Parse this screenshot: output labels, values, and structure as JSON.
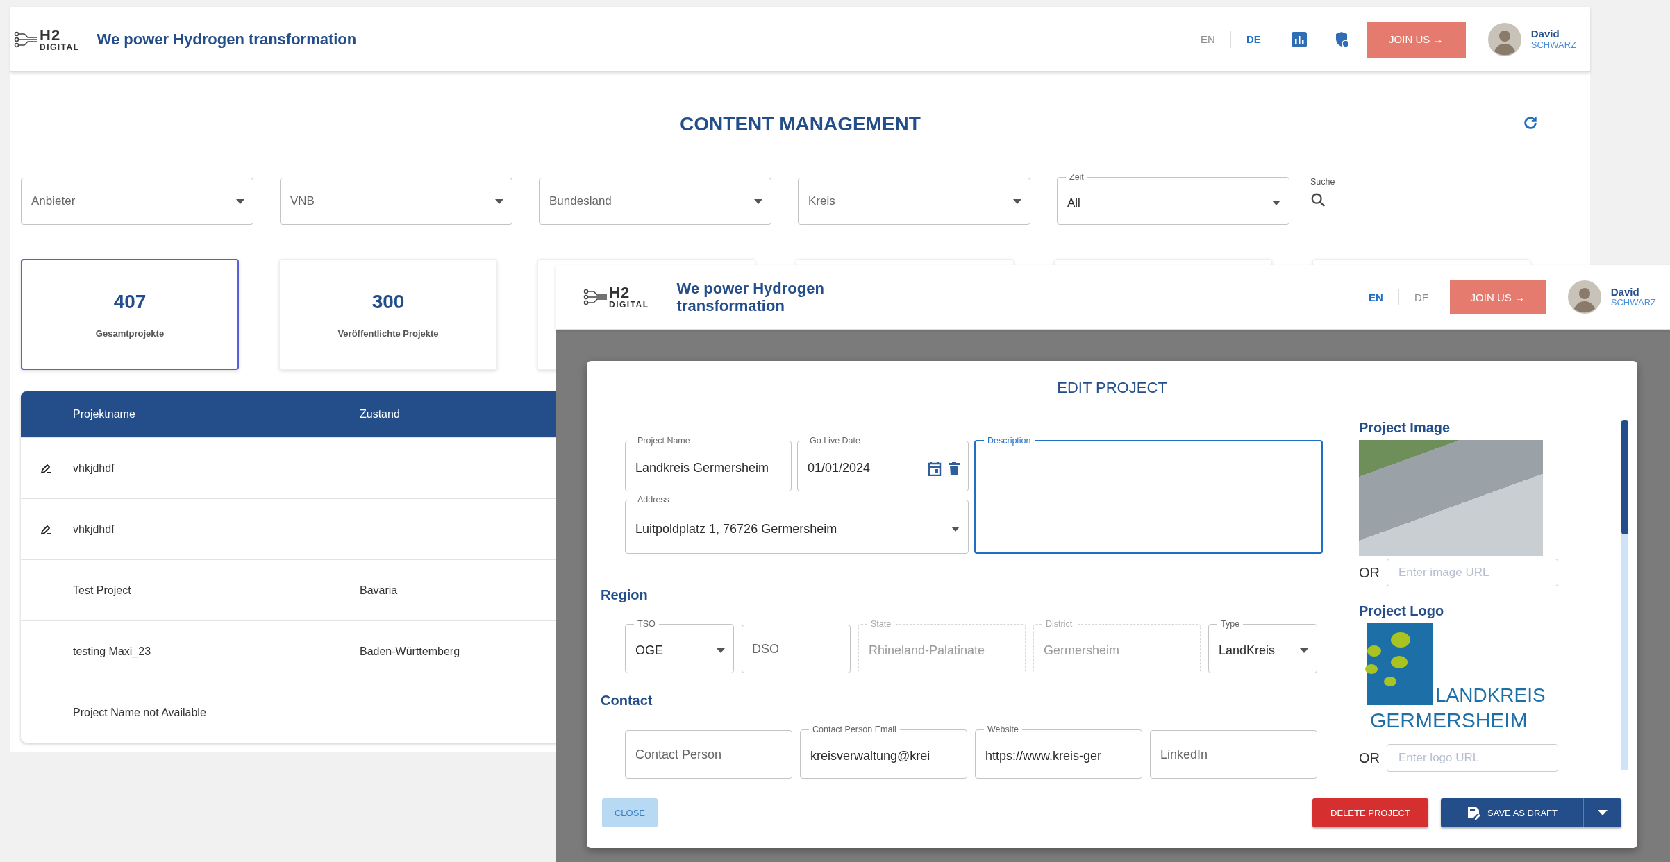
{
  "back_window": {
    "header": {
      "logo": {
        "mark": "H2",
        "word": "DIGITAL"
      },
      "tagline": "We power Hydrogen transformation",
      "languages": [
        {
          "label": "EN",
          "selected": false
        },
        {
          "label": "DE",
          "selected": true
        }
      ],
      "join_button": "JOIN US →",
      "user": {
        "first_name": "David",
        "last_name": "SCHWARZ"
      }
    },
    "title": "CONTENT MANAGEMENT",
    "filters": [
      {
        "kind": "select",
        "placeholder": "Anbieter"
      },
      {
        "kind": "select",
        "placeholder": "VNB"
      },
      {
        "kind": "select",
        "placeholder": "Bundesland"
      },
      {
        "kind": "select",
        "placeholder": "Kreis"
      },
      {
        "kind": "select",
        "label": "Zeit",
        "value": "All"
      }
    ],
    "search": {
      "label": "Suche"
    },
    "cards": [
      {
        "value": "407",
        "label": "Gesamtprojekte",
        "selected": true
      },
      {
        "value": "300",
        "label": "Veröffentlichte Projekte",
        "selected": false
      },
      {
        "selected": false
      },
      {
        "selected": false
      },
      {
        "selected": false
      },
      {
        "selected": false
      }
    ],
    "table": {
      "columns": [
        "Projektname",
        "Zustand"
      ],
      "rows": [
        {
          "editable": true,
          "name": "vhkjdhdf"
        },
        {
          "editable": true,
          "name": "vhkjdhdf"
        },
        {
          "editable": false,
          "name": "Test Project",
          "state": "Bavaria"
        },
        {
          "editable": false,
          "name": "testing Maxi_23",
          "state": "Baden-Württemberg"
        },
        {
          "editable": false,
          "name": "Project Name not Available"
        }
      ]
    }
  },
  "front_window": {
    "header": {
      "logo": {
        "mark": "H2",
        "word": "DIGITAL"
      },
      "tagline": "We power Hydrogen transformation",
      "languages": [
        {
          "label": "EN",
          "selected": true
        },
        {
          "label": "DE",
          "selected": false
        }
      ],
      "join_button": "JOIN US →",
      "user": {
        "first_name": "David",
        "last_name": "SCHWARZ"
      }
    },
    "modal": {
      "title": "EDIT PROJECT",
      "main_fields": [
        {
          "kind": "text",
          "label": "Project Name",
          "value": "Landkreis Germersheim",
          "disabled": false
        },
        {
          "kind": "date",
          "label": "Go Live Date",
          "value": "01/01/2024",
          "disabled": false
        },
        {
          "kind": "textarea",
          "label": "Description",
          "focused": true,
          "disabled": false
        },
        {
          "kind": "select",
          "label": "Address",
          "value": "Luitpoldplatz 1, 76726 Germersheim",
          "disabled": false
        }
      ],
      "sections": [
        {
          "heading": "Region",
          "fields": [
            {
              "kind": "select",
              "label": "TSO",
              "value": "OGE",
              "disabled": false
            },
            {
              "kind": "text",
              "placeholder": "DSO",
              "disabled": false
            },
            {
              "kind": "text",
              "label": "State",
              "value": "Rhineland-Palatinate",
              "disabled": true
            },
            {
              "kind": "text",
              "label": "District",
              "value": "Germersheim",
              "disabled": true
            },
            {
              "kind": "select",
              "label": "Type",
              "value": "LandKreis",
              "disabled": false
            }
          ]
        },
        {
          "heading": "Contact",
          "fields": [
            {
              "kind": "text",
              "placeholder": "Contact Person",
              "disabled": false
            },
            {
              "kind": "text",
              "label": "Contact Person Email",
              "value": "kreisverwaltung@krei",
              "disabled": false
            },
            {
              "kind": "text",
              "label": "Website",
              "value": "https://www.kreis-ger",
              "disabled": false
            },
            {
              "kind": "text",
              "placeholder": "LinkedIn",
              "disabled": false
            }
          ]
        }
      ],
      "media": [
        {
          "kind": "photo",
          "heading": "Project Image",
          "or": "OR",
          "placeholder": "Enter image URL"
        },
        {
          "kind": "logo",
          "heading": "Project Logo",
          "logo_text": [
            "LANDKREIS",
            "GERMERSHEIM"
          ],
          "or": "OR",
          "placeholder": "Enter logo URL"
        }
      ],
      "close_button": {
        "label": "CLOSE",
        "disabled": true
      },
      "delete_button": "DELETE PROJECT",
      "save_button": "SAVE AS DRAFT"
    }
  }
}
